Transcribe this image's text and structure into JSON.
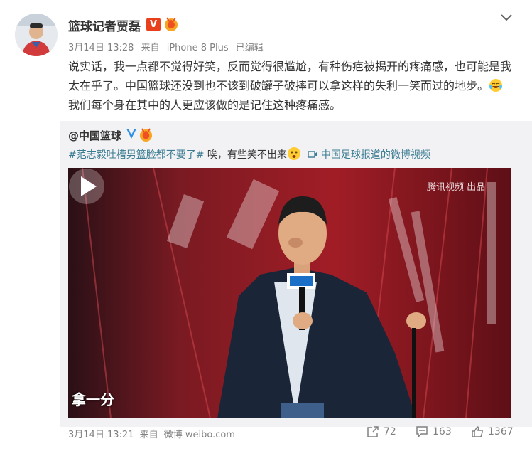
{
  "author": {
    "name": "篮球记者贾磊",
    "verified_badge": "V",
    "icons": [
      "avatar",
      "verified-v-icon",
      "medal-icon",
      "chevron-down-icon"
    ]
  },
  "meta": {
    "date": "3月14日 13:28",
    "source_prefix": "来自",
    "device": "iPhone 8 Plus",
    "edited": "已编辑"
  },
  "post": {
    "text_part1": "说实话，我一点都不觉得好笑，反而觉得很尴尬，有种伤疤被揭开的疼痛感，也可能是我太在乎了。中国篮球还没到也不该到破罐子破摔可以拿这样的失利一笑而过的地步。",
    "text_part2": "我们每个身在其中的人更应该做的是记住这种疼痛感。"
  },
  "repost": {
    "author": "@中国篮球",
    "topic": "#范志毅吐槽男篮脸都不要了#",
    "text": " 唉，有些笑不出来",
    "video_link": "中国足球报道的微博视频",
    "video_caption": "拿一分",
    "video_watermark": "腾讯视频 出品",
    "date": "3月14日 13:21",
    "source_prefix": "来自",
    "source": "微博 weibo.com"
  },
  "stats": {
    "reposts": "72",
    "comments": "163",
    "likes": "1367"
  },
  "colors": {
    "verified_orange": "#e8401c",
    "link_blue": "#3a7c91",
    "muted_gray": "#808080"
  }
}
